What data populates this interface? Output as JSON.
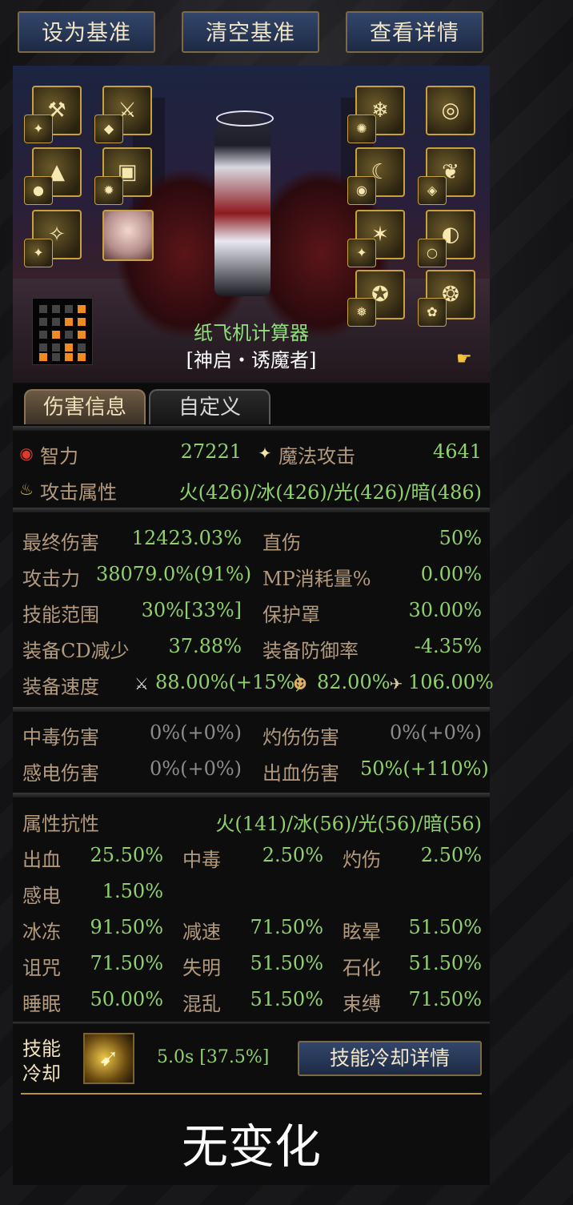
{
  "toolbar": {
    "set_baseline": "设为基准",
    "clear_baseline": "清空基准",
    "view_details": "查看详情"
  },
  "character": {
    "calculator_name": "纸飞机计算器",
    "job_title": "[神启・诱魔者]"
  },
  "tabs": {
    "damage_info": "伤害信息",
    "custom": "自定义"
  },
  "primary_stats": {
    "int_label": "智力",
    "int_value": "27221",
    "matk_label": "魔法攻击",
    "matk_value": "4641",
    "element_label": "攻击属性",
    "element_value": "火(426)/冰(426)/光(426)/暗(486)"
  },
  "damage_stats": {
    "final_damage_label": "最终伤害",
    "final_damage_value": "12423.03%",
    "direct_damage_label": "直伤",
    "direct_damage_value": "50%",
    "attack_label": "攻击力",
    "attack_value": "38079.0%(91%)",
    "mp_cost_label": "MP消耗量%",
    "mp_cost_value": "0.00%",
    "skill_range_label": "技能范围",
    "skill_range_value": "30%[33%]",
    "shield_label": "保护罩",
    "shield_value": "30.00%",
    "cd_reduction_label": "装备CD减少",
    "cd_reduction_value": "37.88%",
    "defense_rate_label": "装备防御率",
    "defense_rate_value": "-4.35%",
    "speed_label": "装备速度",
    "attack_speed_value": "88.00%(+15%)",
    "cast_speed_value": "82.00%",
    "move_speed_value": "106.00%"
  },
  "status_damage": {
    "poison_label": "中毒伤害",
    "poison_value": "0%(+0%)",
    "burn_label": "灼伤伤害",
    "burn_value": "0%(+0%)",
    "shock_label": "感电伤害",
    "shock_value": "0%(+0%)",
    "bleed_label": "出血伤害",
    "bleed_value": "50%(+110%)"
  },
  "resistances": {
    "element_res_label": "属性抗性",
    "element_res_value": "火(141)/冰(56)/光(56)/暗(56)",
    "bleed_label": "出血",
    "bleed_value": "25.50%",
    "poison_label": "中毒",
    "poison_value": "2.50%",
    "burn_label": "灼伤",
    "burn_value": "2.50%",
    "shock_label": "感电",
    "shock_value": "1.50%",
    "freeze_label": "冰冻",
    "freeze_value": "91.50%",
    "slow_label": "减速",
    "slow_value": "71.50%",
    "stun_label": "眩晕",
    "stun_value": "51.50%",
    "curse_label": "诅咒",
    "curse_value": "71.50%",
    "blind_label": "失明",
    "blind_value": "51.50%",
    "petrify_label": "石化",
    "petrify_value": "51.50%",
    "sleep_label": "睡眠",
    "sleep_value": "50.00%",
    "confuse_label": "混乱",
    "confuse_value": "51.50%",
    "bind_label": "束缚",
    "bind_value": "71.50%"
  },
  "skill_cooldown": {
    "label_line1": "技能",
    "label_line2": "冷却",
    "value": "5.0s [37.5%]",
    "details_button": "技能冷却详情"
  },
  "result": {
    "text": "无变化"
  },
  "colors": {
    "label": "#b39a7c",
    "value": "#8fd16a",
    "muted": "#8c8c8c",
    "button_bg": "#1d2a45",
    "gold": "#c9a13a"
  }
}
